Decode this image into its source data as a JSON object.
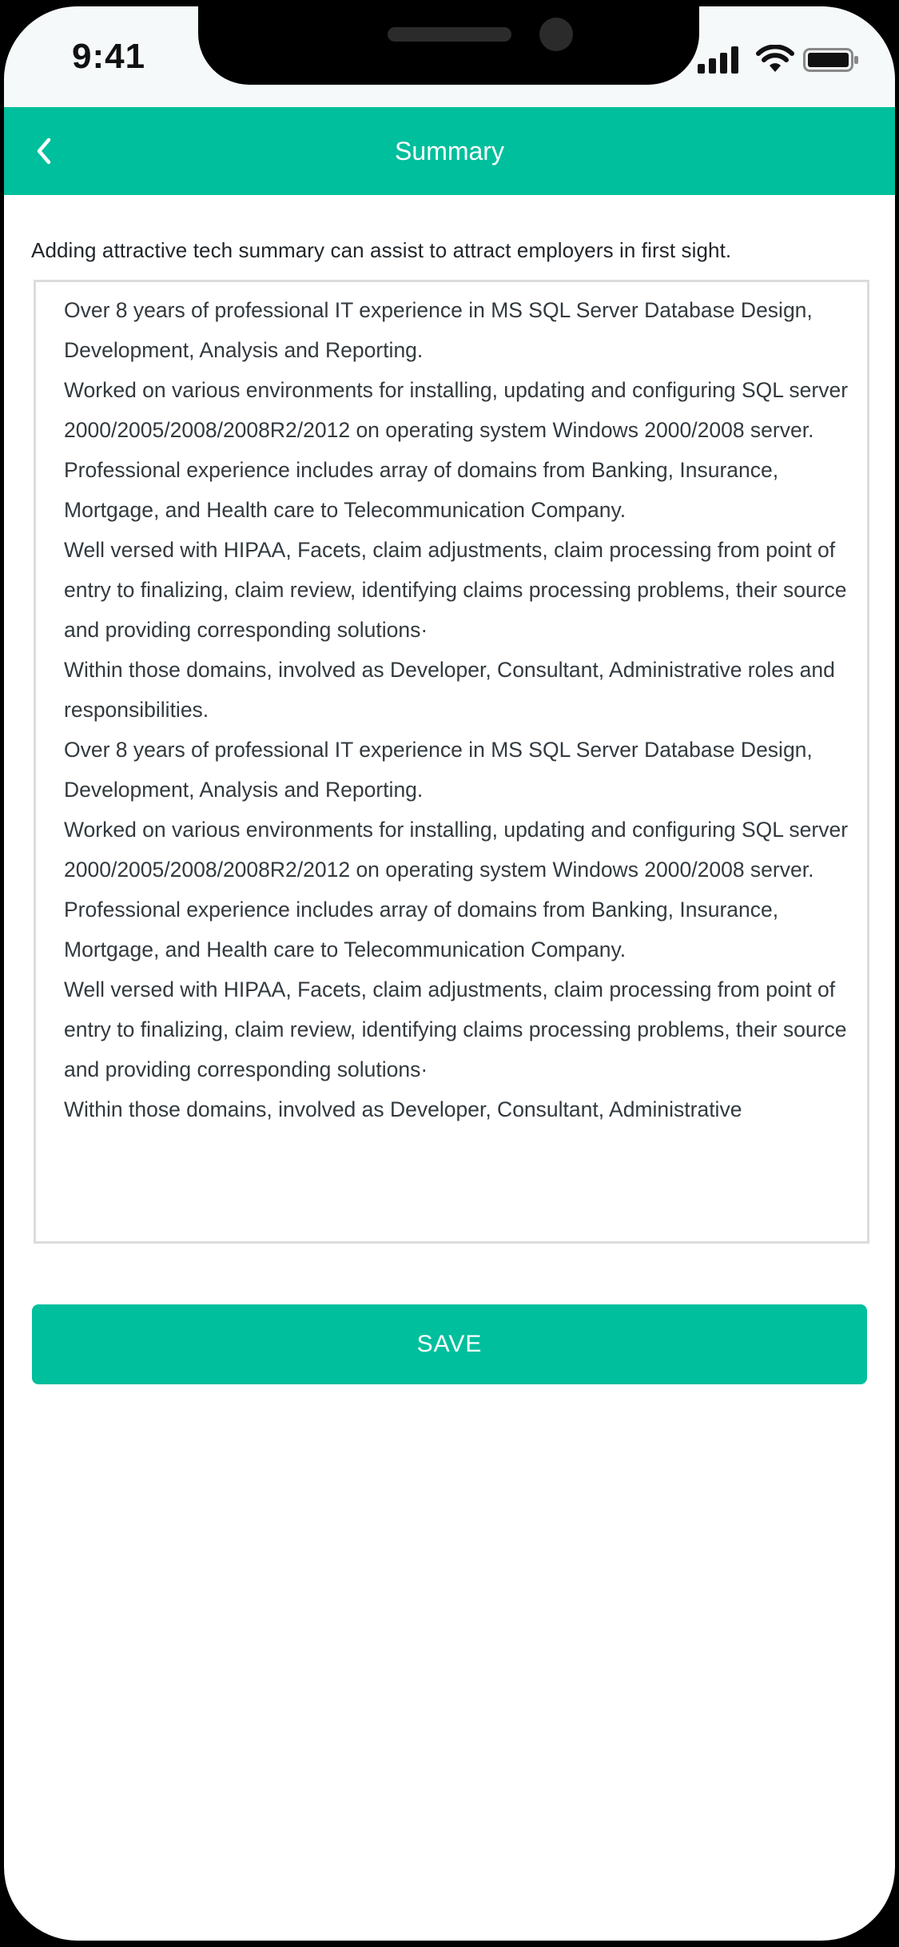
{
  "status_bar": {
    "time": "9:41"
  },
  "header": {
    "back_icon": "chevron-left-icon",
    "title": "Summary"
  },
  "hint": "Adding attractive tech summary can assist to attract employers in first sight.",
  "summary": {
    "paragraphs": [
      "Over 8 years of professional IT experience in MS SQL Server Database Design, Development, Analysis and Reporting.",
      "Worked on various environments for installing, updating and configuring SQL server 2000/2005/2008/2008R2/2012 on operating system Windows 2000/2008 server.",
      "Professional experience includes array of domains from Banking, Insurance, Mortgage, and Health care to Telecommunication Company.",
      "Well versed with HIPAA, Facets, claim adjustments, claim processing from point of entry to finalizing, claim review, identifying claims processing problems, their source and providing corresponding solutions·",
      "Within those domains, involved as Developer, Consultant, Administrative roles and responsibilities.",
      "Over 8 years of professional IT experience in MS SQL Server Database Design, Development, Analysis and Reporting.",
      "Worked on various environments for installing, updating and configuring SQL server 2000/2005/2008/2008R2/2012 on operating system Windows 2000/2008 server.",
      "Professional experience includes array of domains from Banking, Insurance, Mortgage, and Health care to Telecommunication Company.",
      "Well versed with HIPAA, Facets, claim adjustments, claim processing from point of entry to finalizing, claim review, identifying claims processing problems, their source and providing corresponding solutions·",
      "Within those domains, involved as Developer, Consultant, Administrative"
    ]
  },
  "save_button": {
    "label": "SAVE"
  },
  "colors": {
    "accent": "#00bf9c",
    "text": "#323a3f",
    "hint_text": "#20262b",
    "border": "#dcdcdc"
  }
}
